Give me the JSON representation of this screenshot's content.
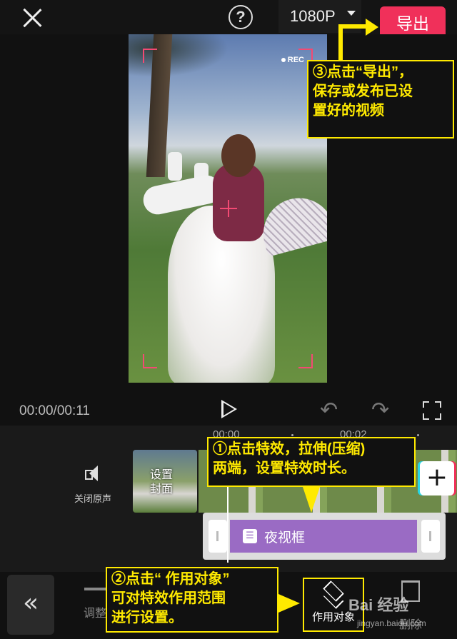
{
  "header": {
    "resolution": "1080P",
    "help": "?",
    "export_label": "导出"
  },
  "preview": {
    "rec_label": "REC"
  },
  "controls": {
    "time": "00:00/00:11",
    "undo_icon": "↶",
    "redo_icon": "↷"
  },
  "timeline": {
    "ruler": [
      "00:00",
      "00:02"
    ],
    "mute_label": "关闭原声",
    "cover_label_line1": "设置",
    "cover_label_line2": "封面",
    "add_icon": "+",
    "effect_icon": "☰",
    "effect_name": "夜视框"
  },
  "bottombar": {
    "back_icon": "«",
    "adjust_label": "调整",
    "target_label": "作用对象",
    "delete_label": "删除"
  },
  "watermark": {
    "brand": "Bai 经验",
    "url": "jingyan.baidu.com"
  },
  "annotations": {
    "export_tip_1": "③点击“导出”，",
    "export_tip_2": "保存或发布已设",
    "export_tip_3": "置好的视频",
    "effect_tip_1": "①点击特效，拉伸(压缩)",
    "effect_tip_2": "两端，设置特效时长。",
    "target_tip_1": "②点击“ 作用对象”",
    "target_tip_2": "可对特效作用范围",
    "target_tip_3": "进行设置。"
  },
  "icons": [
    "close-icon",
    "help-icon",
    "caret-down-icon",
    "play-icon",
    "undo-icon",
    "redo-icon",
    "fullscreen-icon",
    "speaker-icon",
    "add-icon",
    "layers-icon",
    "adjust-icon",
    "delete-icon",
    "double-chevron-left-icon"
  ],
  "colors": {
    "accent": "#f0305a",
    "effect": "#9a6bc4",
    "annotation": "#ffea00"
  }
}
